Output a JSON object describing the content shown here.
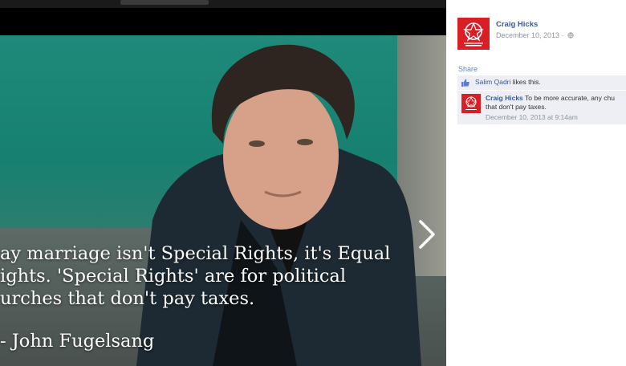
{
  "post": {
    "author": "Craig Hicks",
    "date": "December 10, 2013 ·",
    "audience_icon": "globe-icon",
    "logo_icon": "equality-logo-icon"
  },
  "photo": {
    "quote_lines": [
      "ay marriage isn't Special Rights, it's Equal",
      "ights. 'Special Rights' are for political",
      "urches that don't pay taxes."
    ],
    "attribution": "John Fugelsang",
    "next_icon": "chevron-right-icon"
  },
  "actions": {
    "share_label": "Share"
  },
  "likes": {
    "icon": "thumbs-up-icon",
    "liker": "Salim Qadri",
    "suffix": " likes this."
  },
  "comment": {
    "author": "Craig Hicks",
    "text_line1": " To be more accurate, any chu",
    "text_line2": "that don't pay taxes.",
    "date": "December 10, 2013 at 9:14am"
  },
  "colors": {
    "link": "#3b5998",
    "brand_red": "#d81f26",
    "panel_bg": "#edeff4",
    "muted": "#90949c"
  }
}
